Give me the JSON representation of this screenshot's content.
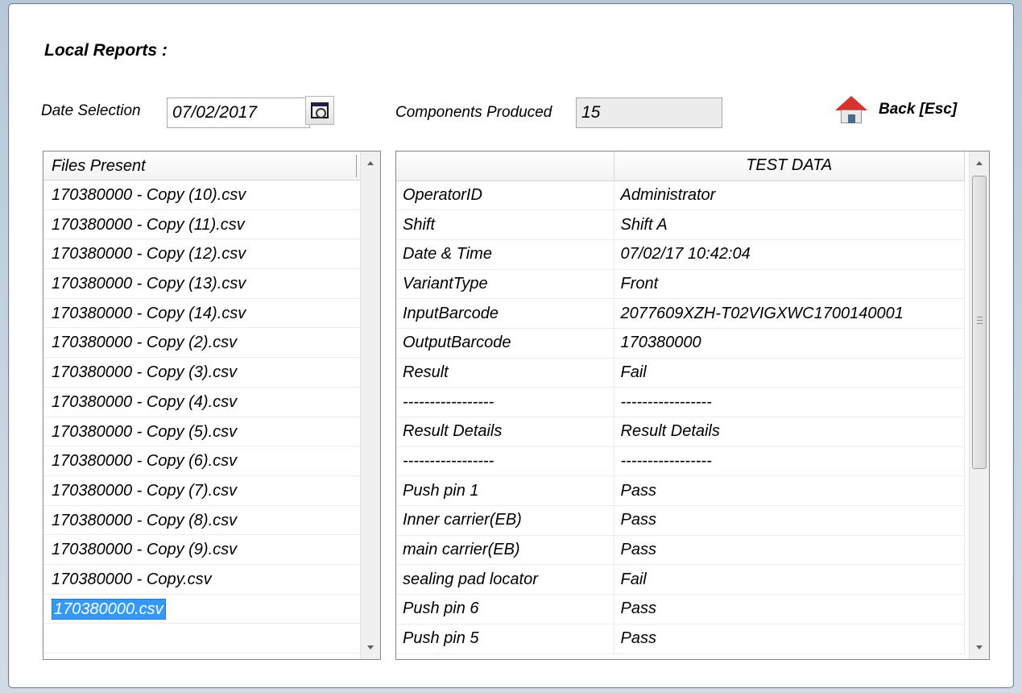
{
  "title": "Local Reports :",
  "date_selection": {
    "label": "Date Selection",
    "value": "07/02/2017"
  },
  "components": {
    "label": "Components Produced",
    "value": "15"
  },
  "back": {
    "label": "Back [Esc]"
  },
  "files": {
    "header": "Files Present",
    "items": [
      "170380000 - Copy (10).csv",
      "170380000 - Copy (11).csv",
      "170380000 - Copy (12).csv",
      "170380000 - Copy (13).csv",
      "170380000 - Copy (14).csv",
      "170380000 - Copy (2).csv",
      "170380000 - Copy (3).csv",
      "170380000 - Copy (4).csv",
      "170380000 - Copy (5).csv",
      "170380000 - Copy (6).csv",
      "170380000 - Copy (7).csv",
      "170380000 - Copy (8).csv",
      "170380000 - Copy (9).csv",
      "170380000 - Copy.csv",
      "170380000.csv"
    ],
    "selected_index": 14
  },
  "test_data": {
    "header": "TEST DATA",
    "rows": [
      [
        "OperatorID",
        "Administrator"
      ],
      [
        "Shift",
        "Shift A"
      ],
      [
        "Date & Time",
        "07/02/17    10:42:04"
      ],
      [
        "VariantType",
        "Front"
      ],
      [
        "InputBarcode",
        "2077609XZH-T02VIGXWC1700140001"
      ],
      [
        "OutputBarcode",
        "170380000"
      ],
      [
        "Result",
        "Fail"
      ],
      [
        "-----------------",
        "-----------------"
      ],
      [
        "Result Details",
        "Result Details"
      ],
      [
        "-----------------",
        "-----------------"
      ],
      [
        "Push pin 1",
        "Pass"
      ],
      [
        "Inner carrier(EB)",
        "Pass"
      ],
      [
        "main carrier(EB)",
        "Pass"
      ],
      [
        "sealing pad locator",
        "Fail"
      ],
      [
        "Push pin 6",
        "Pass"
      ],
      [
        "Push pin 5",
        "Pass"
      ]
    ]
  },
  "colors": {
    "selection": "#3399ff",
    "home_roof": "#d8322a"
  }
}
